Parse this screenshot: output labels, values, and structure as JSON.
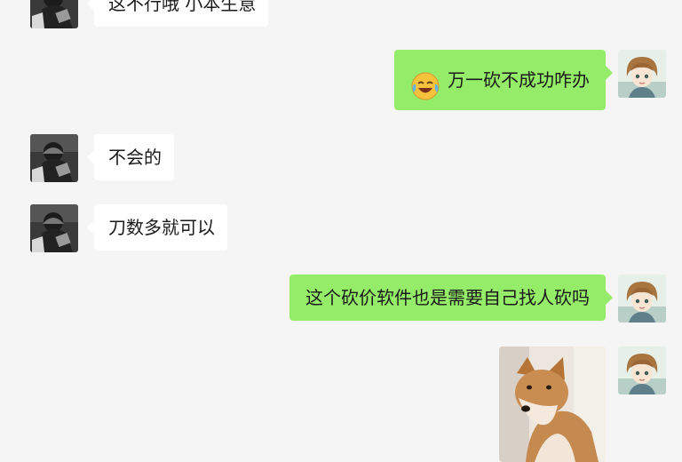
{
  "messages": [
    {
      "side": "left",
      "text": "这不行哦 小本生意"
    },
    {
      "side": "right",
      "text": "万一砍不成功咋办",
      "emoji": "laughing-crying-emoji-icon"
    },
    {
      "side": "left",
      "text": "不会的"
    },
    {
      "side": "left",
      "text": "刀数多就可以"
    },
    {
      "side": "right",
      "text": "这个砍价软件也是需要自己找人砍吗"
    },
    {
      "side": "right",
      "image": "shiba-dog-photo"
    }
  ],
  "colors": {
    "background": "#f5f5f5",
    "incoming_bubble": "#ffffff",
    "outgoing_bubble": "#95ec69",
    "text": "#1a1a1a"
  }
}
